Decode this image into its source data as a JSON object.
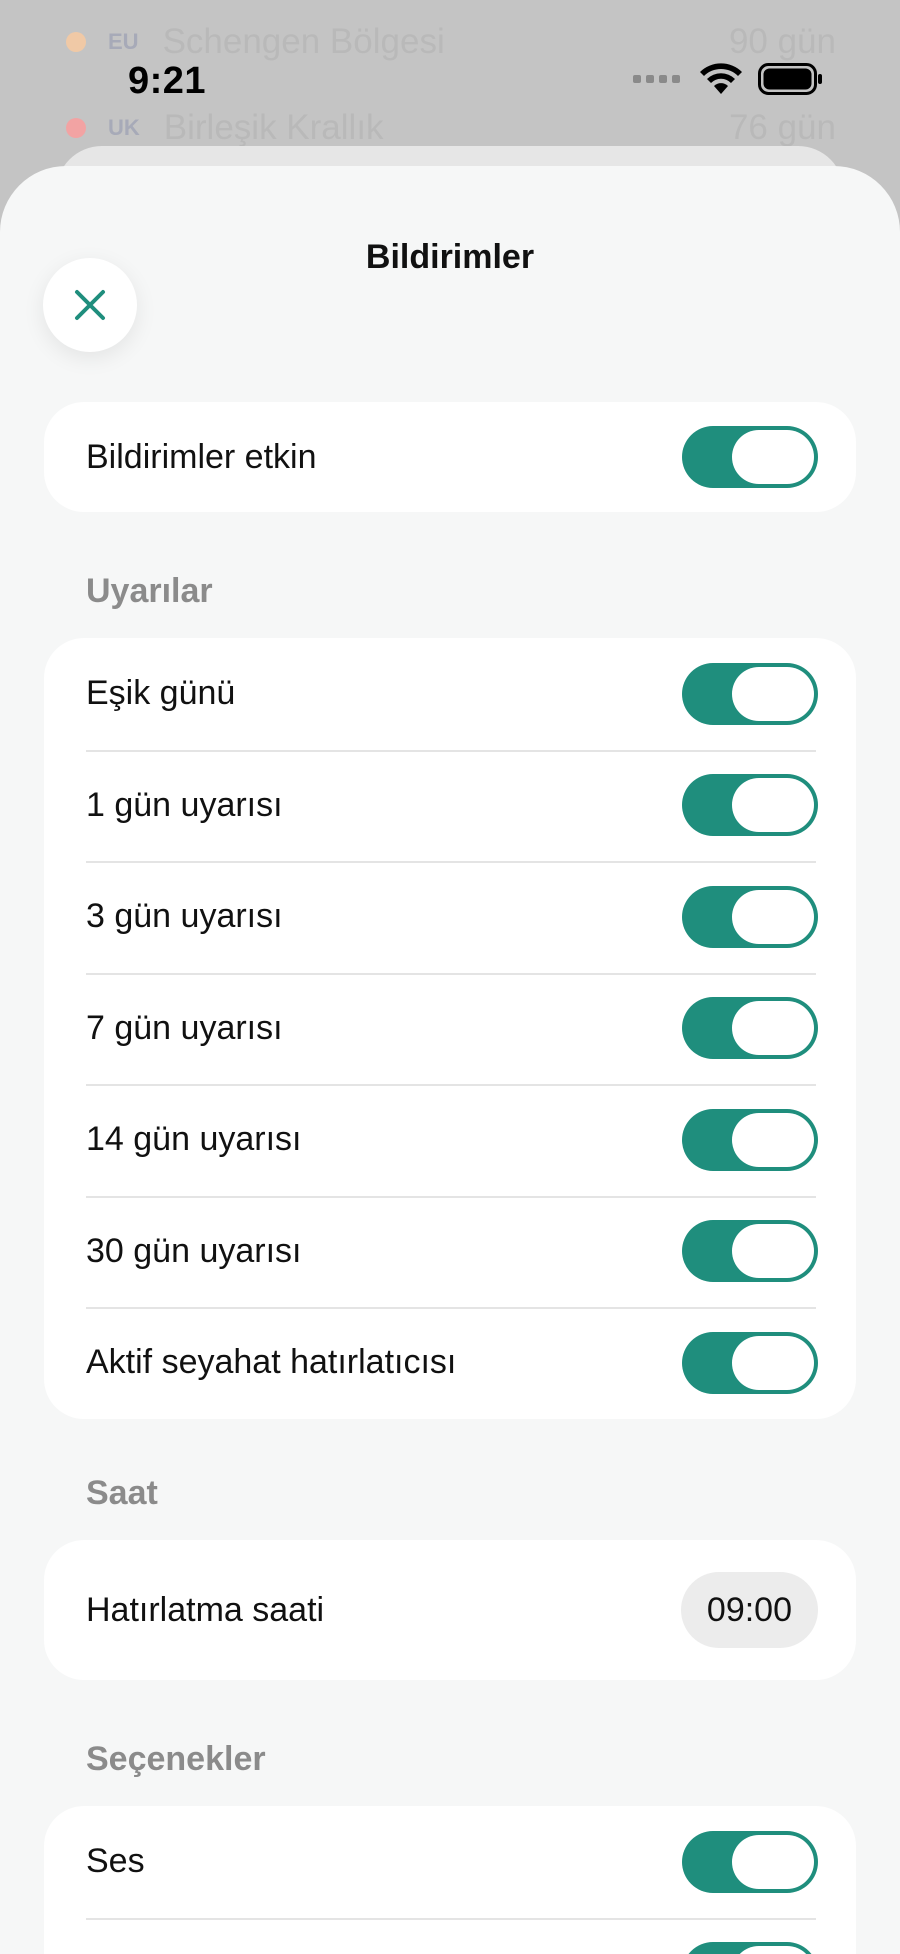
{
  "background_list": [
    {
      "name": "Schengen Bölgesi",
      "value": "90 gün",
      "flag": "EU",
      "dot_color": "#f0c9a6"
    },
    {
      "name": "Birleşik Krallık",
      "value": "76 gün",
      "flag": "UK",
      "dot_color": "#f2a3a3"
    }
  ],
  "status_bar": {
    "time": "9:21"
  },
  "header": {
    "title": "Bildirimler",
    "close_icon": "close-icon"
  },
  "master": {
    "label": "Bildirimler etkin",
    "on": true
  },
  "sections": {
    "alerts": {
      "title": "Uyarılar",
      "items": [
        {
          "label": "Eşik günü",
          "on": true
        },
        {
          "label": "1 gün uyarısı",
          "on": true
        },
        {
          "label": "3 gün uyarısı",
          "on": true
        },
        {
          "label": "7 gün uyarısı",
          "on": true
        },
        {
          "label": "14 gün uyarısı",
          "on": true
        },
        {
          "label": "30 gün uyarısı",
          "on": true
        },
        {
          "label": "Aktif seyahat hatırlatıcısı",
          "on": true
        }
      ]
    },
    "time": {
      "title": "Saat",
      "reminder_label": "Hatırlatma saati",
      "reminder_value": "09:00"
    },
    "options": {
      "title": "Seçenekler",
      "items": [
        {
          "label": "Ses",
          "on": true
        }
      ]
    }
  },
  "colors": {
    "accent": "#1f8e7d",
    "sheet_bg": "#f6f7f7",
    "section_header": "#8b8b8b"
  }
}
